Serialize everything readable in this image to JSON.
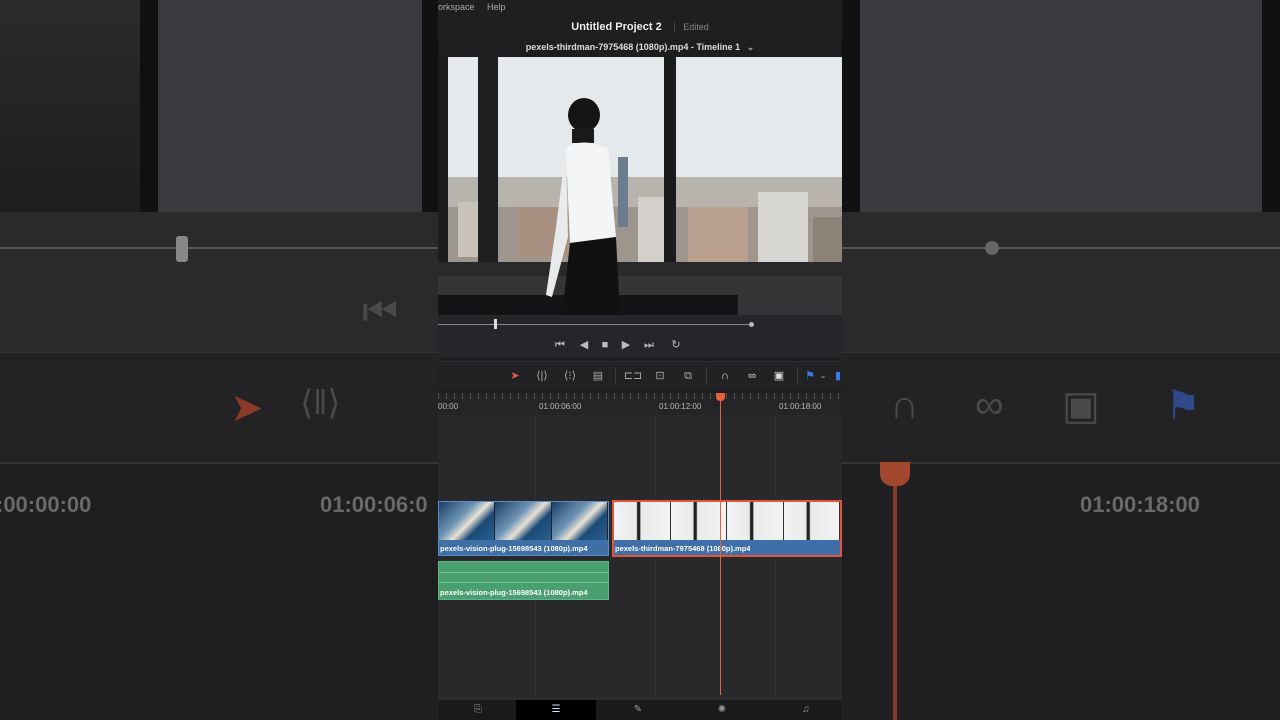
{
  "app": {
    "menu": [
      "orkspace",
      "Help"
    ],
    "project_title": "Untitled Project 2",
    "project_state": "Edited",
    "clip_title": "pexels-thirdman-7975468 (1080p).mp4 - Timeline 1"
  },
  "transport": {
    "scrub_position": 0.18,
    "buttons": [
      "skip-back-icon",
      "step-back-icon",
      "stop-icon",
      "play-icon",
      "skip-forward-icon",
      "loop-icon"
    ]
  },
  "toolbar": {
    "tools": [
      "selection-arrow-icon",
      "trim-icon",
      "dynamic-trim-icon",
      "blade-icon",
      "insert-icon",
      "overwrite-icon",
      "replace-icon",
      "snapping-icon",
      "link-icon",
      "lock-icon",
      "flag-icon"
    ]
  },
  "timeline": {
    "timecodes": [
      "00:00",
      "01:00:06:00",
      "01:00:12:00",
      "01:00:18:00"
    ],
    "clips": {
      "video_1": "pexels-vision-plug-15698543 (1080p).mp4",
      "video_2": "pexels-thirdman-7975468 (1080p).mp4",
      "audio_1": "pexels-vision-plug-15698543 (1080p).mp4"
    }
  },
  "background": {
    "timecodes": [
      ":00:00:00",
      "01:00:06:0",
      "01:00:18:00"
    ]
  },
  "pages": [
    "media-page-icon",
    "cut-page-icon",
    "edit-page-icon",
    "color-page-icon",
    "fairlight-page-icon"
  ],
  "colors": {
    "accent": "#e8603c",
    "video_clip": "#3f6fa6",
    "audio_clip": "#4a9f6f"
  }
}
